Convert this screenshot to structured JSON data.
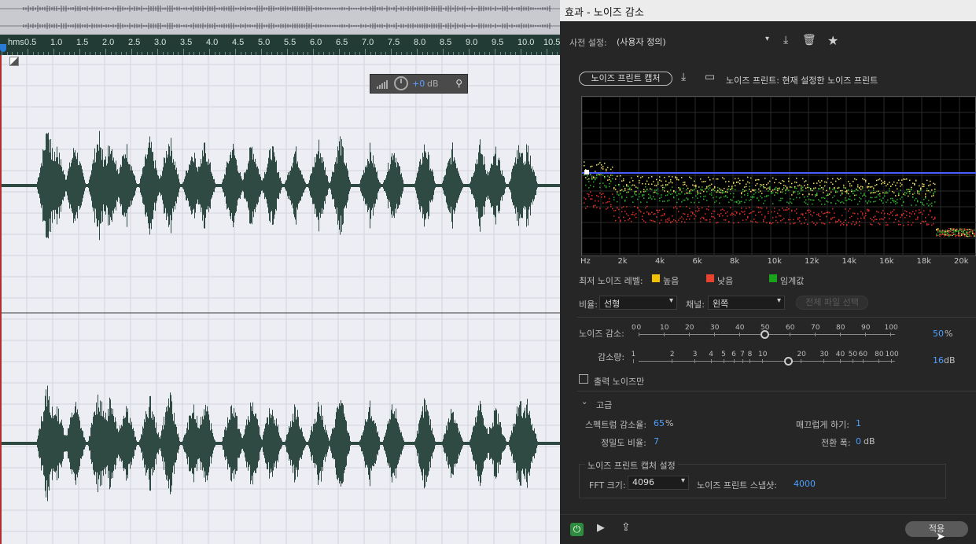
{
  "editor": {
    "ruler_labels": [
      "hms",
      "0.5",
      "1.0",
      "1.5",
      "2.0",
      "2.5",
      "3.0",
      "3.5",
      "4.0",
      "4.5",
      "5.0",
      "5.5",
      "6.0",
      "6.5",
      "7.0",
      "7.5",
      "8.0",
      "8.5",
      "9.0",
      "9.5",
      "10.0",
      "10.5"
    ],
    "hud": {
      "value": "+0",
      "unit": "dB"
    }
  },
  "panel": {
    "title": "효과 - 노이즈 감소",
    "preset_label": "사전 설정:",
    "preset_value": "(사용자 정의)",
    "capture_button": "노이즈 프린트 캡처",
    "noise_print_label": "노이즈 프린트: 현재 설정한 노이즈 프린트",
    "freq_labels": [
      "Hz",
      "2k",
      "4k",
      "6k",
      "8k",
      "10k",
      "12k",
      "14k",
      "16k",
      "18k",
      "20k"
    ],
    "legend_title": "최저 노이즈 레벨:",
    "legend": [
      {
        "label": "높음",
        "color": "#f2c200"
      },
      {
        "label": "낮음",
        "color": "#e8432f"
      },
      {
        "label": "임계값",
        "color": "#1aa31a"
      }
    ],
    "scale_label": "비율:",
    "scale_value": "선형",
    "channel_label": "채널:",
    "channel_value": "왼쪽",
    "select_all_button": "전체 파일 선택",
    "noise_reduction_label": "노이즈 감소:",
    "noise_reduction_ticks": [
      "0",
      "10",
      "20",
      "30",
      "40",
      "50",
      "60",
      "70",
      "80",
      "90",
      "100"
    ],
    "noise_reduction_zero": "0",
    "noise_reduction_value": "50",
    "noise_reduction_unit": "%",
    "reduce_by_label": "감소량:",
    "reduce_by_ticks": [
      "1",
      "2",
      "3",
      "4",
      "5",
      "6",
      "7",
      "8",
      "10",
      "20",
      "30",
      "40",
      "50",
      "60",
      "80",
      "100"
    ],
    "reduce_by_value": "16",
    "reduce_by_unit": "dB",
    "output_noise_only": "출력 노이즈만",
    "advanced_label": "고급",
    "spectral_decay_label": "스펙트럼 감소율:",
    "spectral_decay_value": "65",
    "spectral_decay_unit": "%",
    "smoothing_label": "매끄럽게 하기:",
    "smoothing_value": "1",
    "precision_label": "정밀도 비율:",
    "precision_value": "7",
    "transition_label": "전환 폭:",
    "transition_value": "0",
    "transition_unit": "dB",
    "capture_settings_label": "노이즈 프린트 캡처 설정",
    "fft_label": "FFT 크기:",
    "fft_value": "4096",
    "snapshots_label": "노이즈 프린트 스냅샷:",
    "snapshots_value": "4000",
    "apply_button": "적용"
  }
}
